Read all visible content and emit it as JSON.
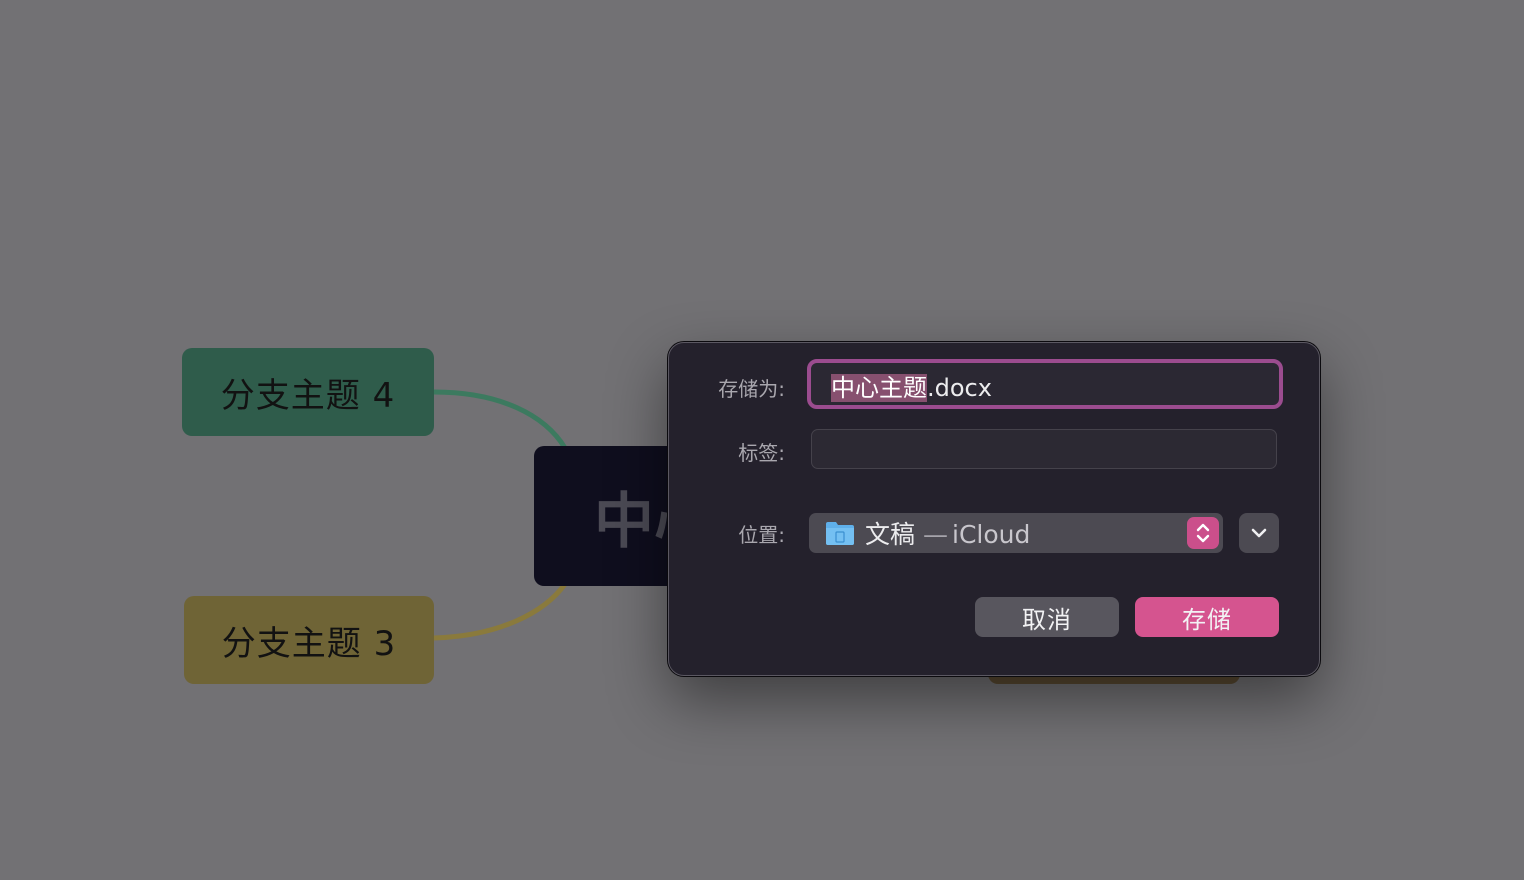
{
  "mindmap": {
    "branch_4": "分支主题 4",
    "branch_3": "分支主题 3",
    "central_partial": "中心",
    "colors": {
      "branch_4": "#2f5c4b",
      "branch_3": "#6f6436",
      "central": "#0f0e1e",
      "link_green": "#3c7a5f",
      "link_yellow": "#8a7a3c"
    }
  },
  "save_dialog": {
    "save_as_label": "存储为:",
    "filename_selected": "中心主题",
    "filename_extension": ".docx",
    "tags_label": "标签:",
    "tags_value": "",
    "location_label": "位置:",
    "location_name": "文稿",
    "location_separator": "—",
    "location_cloud": "iCloud",
    "cancel_label": "取消",
    "save_label": "存储",
    "icons": {
      "folder": "folder-icon",
      "stepper": "stepper-icon",
      "expand": "chevron-down-icon"
    },
    "colors": {
      "accent": "#d5548f",
      "focus_ring": "#9b4c8f",
      "dialog_bg": "#24212c"
    }
  }
}
